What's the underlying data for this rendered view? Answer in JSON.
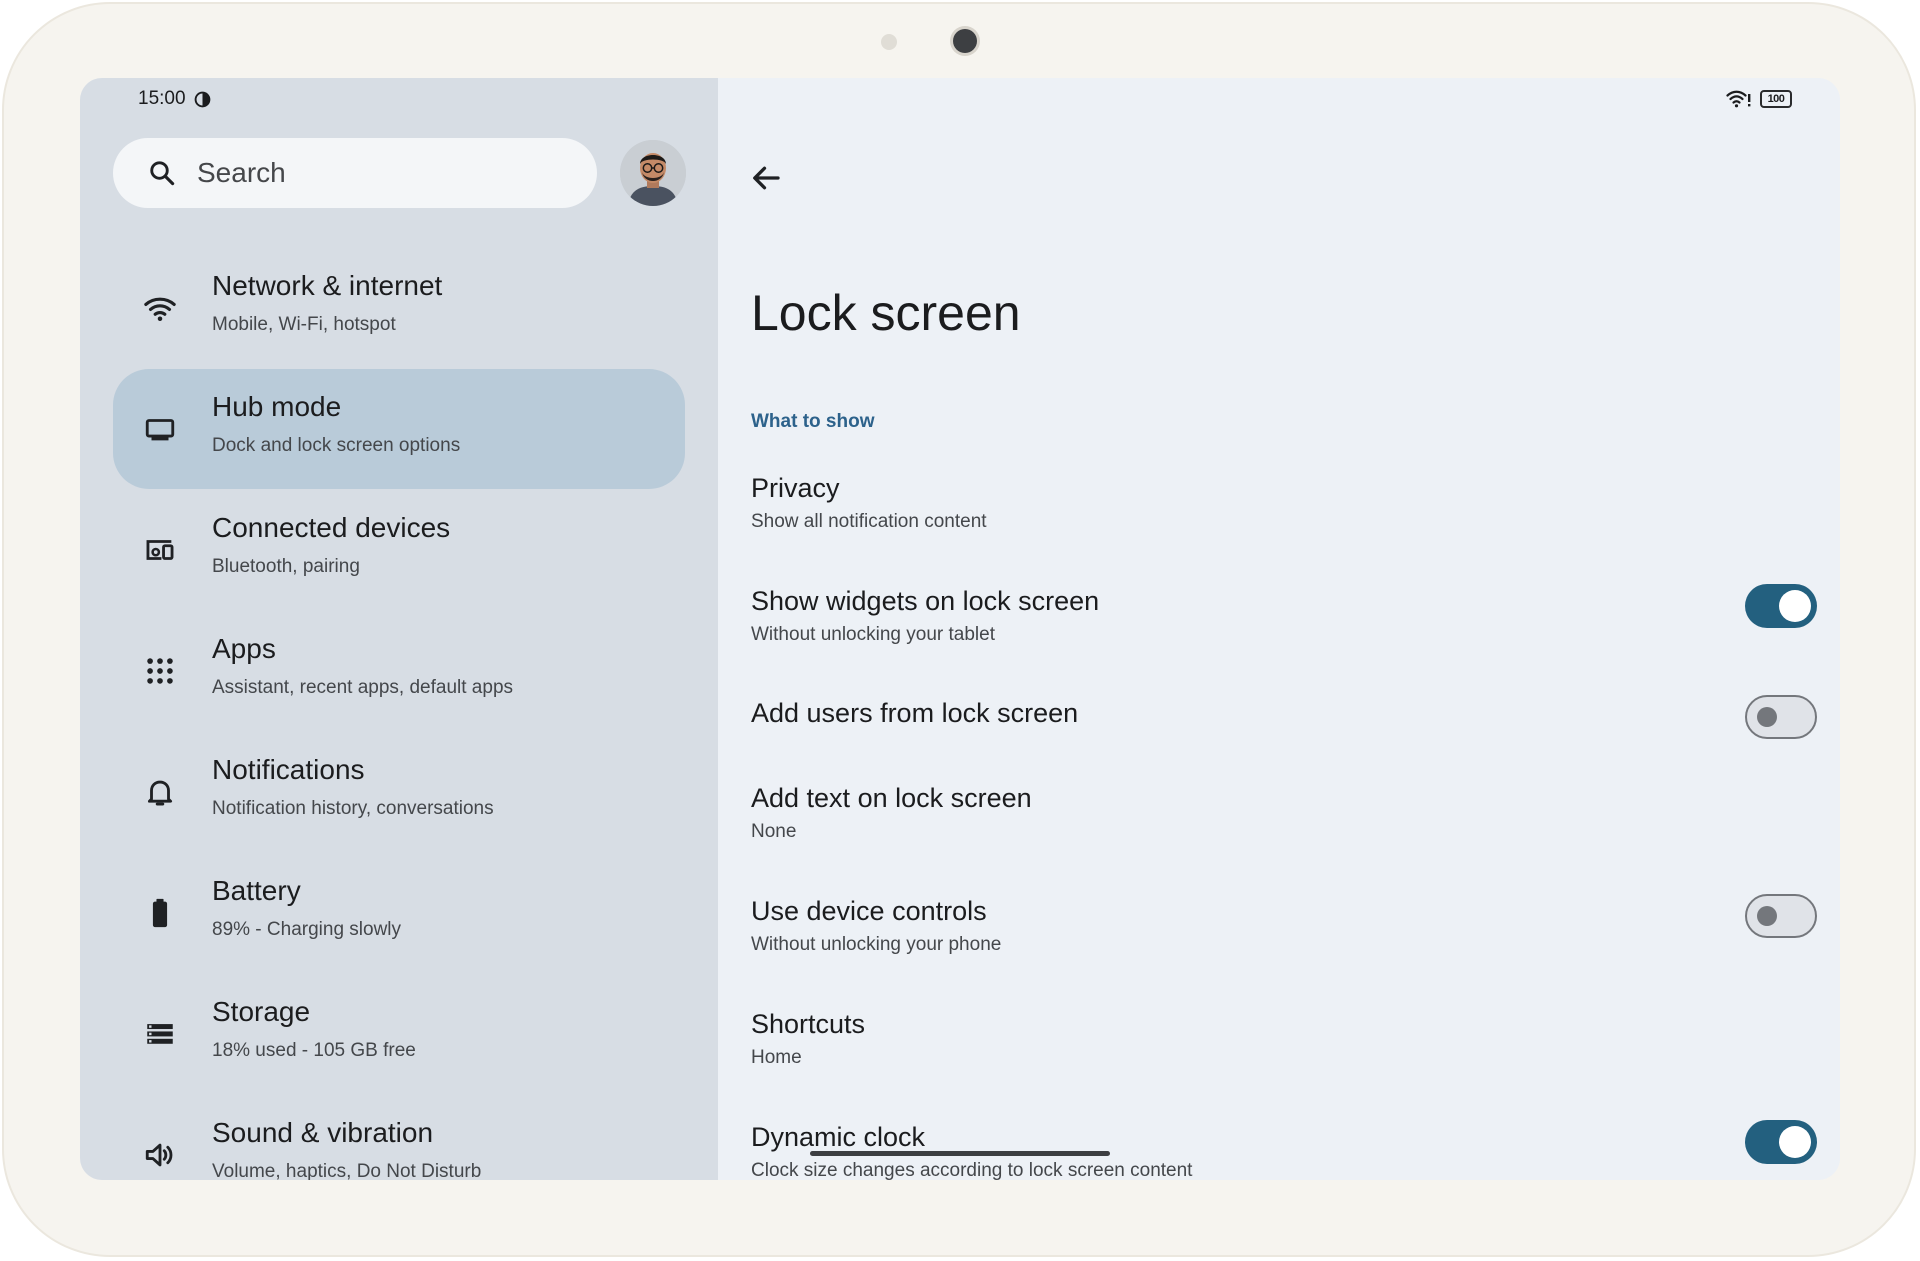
{
  "status_bar": {
    "time": "15:00",
    "battery": "100"
  },
  "search": {
    "placeholder": "Search"
  },
  "nav": [
    {
      "title": "Network & internet",
      "subtitle": "Mobile, Wi-Fi, hotspot",
      "icon": "wifi-icon"
    },
    {
      "title": "Hub mode",
      "subtitle": "Dock and lock screen options",
      "icon": "tablet-icon",
      "selected": true
    },
    {
      "title": "Connected devices",
      "subtitle": "Bluetooth, pairing",
      "icon": "devices-icon"
    },
    {
      "title": "Apps",
      "subtitle": "Assistant, recent apps, default apps",
      "icon": "apps-grid-icon"
    },
    {
      "title": "Notifications",
      "subtitle": "Notification history, conversations",
      "icon": "bell-icon"
    },
    {
      "title": "Battery",
      "subtitle": "89% - Charging slowly",
      "icon": "battery-icon"
    },
    {
      "title": "Storage",
      "subtitle": "18% used - 105 GB free",
      "icon": "storage-icon"
    },
    {
      "title": "Sound & vibration",
      "subtitle": "Volume, haptics, Do Not Disturb",
      "icon": "speaker-icon"
    }
  ],
  "main": {
    "title": "Lock screen",
    "section_label": "What to show",
    "rows": [
      {
        "title": "Privacy",
        "subtitle": "Show all notification content"
      },
      {
        "title": "Show widgets on lock screen",
        "subtitle": "Without unlocking your tablet",
        "toggle": "on"
      },
      {
        "title": "Add users from lock screen",
        "subtitle": "",
        "toggle": "off"
      },
      {
        "title": "Add text on lock screen",
        "subtitle": "None"
      },
      {
        "title": "Use device controls",
        "subtitle": "Without unlocking your phone",
        "toggle": "off"
      },
      {
        "title": "Shortcuts",
        "subtitle": "Home"
      },
      {
        "title": "Dynamic clock",
        "subtitle": "Clock size changes according to lock screen content",
        "toggle": "on"
      }
    ]
  },
  "colors": {
    "accent": "#23607f",
    "selected_nav": "#b9cbd9",
    "section_label": "#2d628b",
    "sidebar_bg": "#d7dde4",
    "content_bg": "#edf1f6"
  }
}
